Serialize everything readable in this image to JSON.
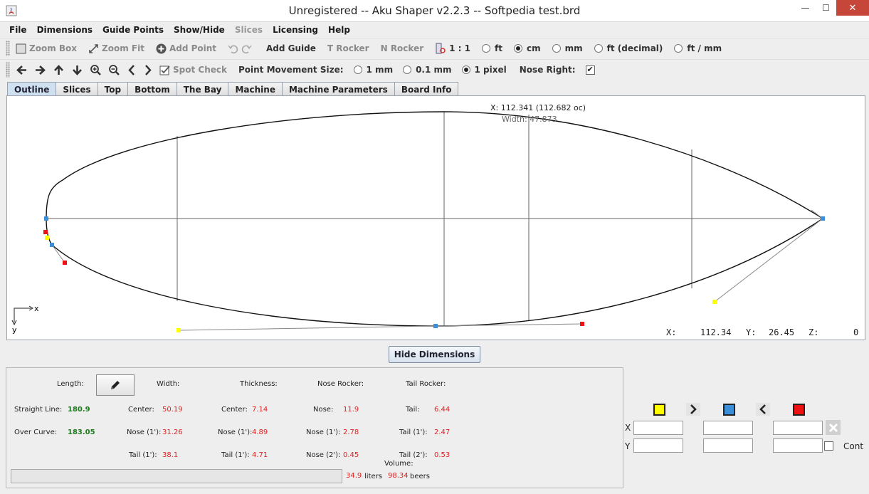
{
  "window": {
    "title": "Unregistered -- Aku Shaper v2.2.3  --  Softpedia test.brd",
    "min_glyph": "—",
    "max_glyph": "☐",
    "close_glyph": "✕"
  },
  "menu": [
    {
      "label": "File",
      "enabled": true
    },
    {
      "label": "Dimensions",
      "enabled": true
    },
    {
      "label": "Guide Points",
      "enabled": true
    },
    {
      "label": "Show/Hide",
      "enabled": true
    },
    {
      "label": "Slices",
      "enabled": false
    },
    {
      "label": "Licensing",
      "enabled": true
    },
    {
      "label": "Help",
      "enabled": true
    }
  ],
  "toolbar1": {
    "zoom_box": "Zoom Box",
    "zoom_fit": "Zoom Fit",
    "add_point": "Add Point",
    "add_guide": "Add Guide",
    "t_rocker": "T Rocker",
    "n_rocker": "N Rocker",
    "scale": "1 : 1",
    "units": [
      {
        "label": "ft",
        "selected": false
      },
      {
        "label": "cm",
        "selected": true
      },
      {
        "label": "mm",
        "selected": false
      },
      {
        "label": "ft (decimal)",
        "selected": false
      },
      {
        "label": "ft / mm",
        "selected": false
      }
    ]
  },
  "toolbar2": {
    "spot_check": "Spot Check",
    "point_movement_label": "Point Movement Size:",
    "movement_options": [
      {
        "label": "1 mm",
        "selected": false
      },
      {
        "label": "0.1 mm",
        "selected": false
      },
      {
        "label": "1 pixel",
        "selected": true
      }
    ],
    "nose_right_label": "Nose Right:",
    "nose_right_checked": true
  },
  "tabs": [
    {
      "label": "Outline",
      "active": true
    },
    {
      "label": "Slices",
      "active": false
    },
    {
      "label": "Top",
      "active": false
    },
    {
      "label": "Bottom",
      "active": false
    },
    {
      "label": "The Bay",
      "active": false
    },
    {
      "label": "Machine",
      "active": false
    },
    {
      "label": "Machine Parameters",
      "active": false
    },
    {
      "label": "Board Info",
      "active": false
    }
  ],
  "canvas": {
    "x_readout": "X: 112.341 (112.682 oc)",
    "width_readout": "Width: 47.873",
    "axis_x": "x",
    "axis_y": "y",
    "coord_x_label": "X:",
    "coord_x": "112.34",
    "coord_y_label": "Y:",
    "coord_y": "26.45",
    "coord_z_label": "Z:",
    "coord_z": "0"
  },
  "hide_dimensions": "Hide Dimensions",
  "dimensions": {
    "length_label": "Length:",
    "width_label": "Width:",
    "thickness_label": "Thickness:",
    "nose_rocker_label": "Nose Rocker:",
    "tail_rocker_label": "Tail Rocker:",
    "straight_line_label": "Straight Line:",
    "straight_line": "180.9",
    "over_curve_label": "Over Curve:",
    "over_curve": "183.05",
    "width": {
      "center_label": "Center:",
      "center": "50.19",
      "nose_label": "Nose (1'):",
      "nose": "31.26",
      "tail_label": "Tail (1'):",
      "tail": "38.1"
    },
    "thickness": {
      "center_label": "Center:",
      "center": "7.14",
      "nose_label": "Nose (1'):",
      "nose": "4.89",
      "tail_label": "Tail (1'):",
      "tail": "4.71"
    },
    "nose_rocker": {
      "nose_label": "Nose:",
      "nose": "11.9",
      "nose1_label": "Nose (1'):",
      "nose1": "2.78",
      "nose2_label": "Nose (2'):",
      "nose2": "0.45"
    },
    "tail_rocker": {
      "tail_label": "Tail:",
      "tail": "6.44",
      "tail1_label": "Tail (1'):",
      "tail1": "2.47",
      "tail2_label": "Tail (2'):",
      "tail2": "0.53"
    },
    "volume_label": "Volume:",
    "volume_liters": "34.9",
    "liters_label": "liters",
    "volume_beers": "98.34",
    "beers_label": "beers"
  },
  "control_points": {
    "x_label": "X",
    "y_label": "Y",
    "cont_label": "Cont",
    "colors": {
      "yellow": "#ffff00",
      "blue": "#3a8fd8",
      "red": "#ee1111"
    }
  }
}
